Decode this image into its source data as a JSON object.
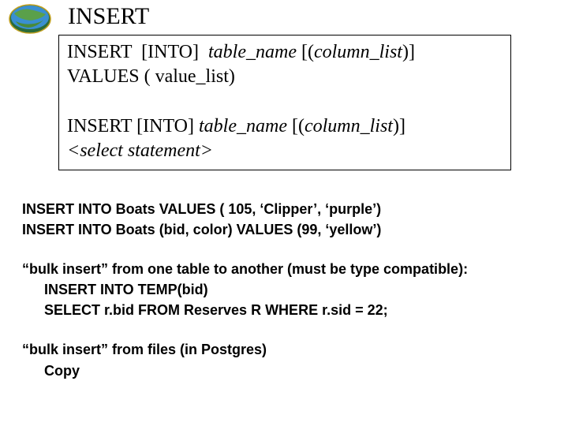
{
  "title": "INSERT",
  "syntax": {
    "line1a": "INSERT  [INTO]  ",
    "line1b": "table_name ",
    "line1c": "[(",
    "line1d": "column_list",
    "line1e": ")]",
    "line2": "VALUES ( value_list)",
    "blank": " ",
    "line3a": "INSERT [INTO] ",
    "line3b": "table_name ",
    "line3c": "[(",
    "line3d": "column_list",
    "line3e": ")]",
    "line4": "<select statement>"
  },
  "body": {
    "ex1": "INSERT INTO Boats VALUES ( 105, ‘Clipper’, ‘purple’)",
    "ex2": "INSERT INTO Boats  (bid, color) VALUES (99, ‘yellow’)",
    "bulk1_intro": "“bulk insert” from one table to another (must be type compatible):",
    "bulk1_l1": "INSERT INTO TEMP(bid)",
    "bulk1_l2": "SELECT r.bid FROM Reserves R WHERE  r.sid = 22;",
    "bulk2_intro": "“bulk insert” from files (in Postgres)",
    "bulk2_l1": "Copy"
  }
}
